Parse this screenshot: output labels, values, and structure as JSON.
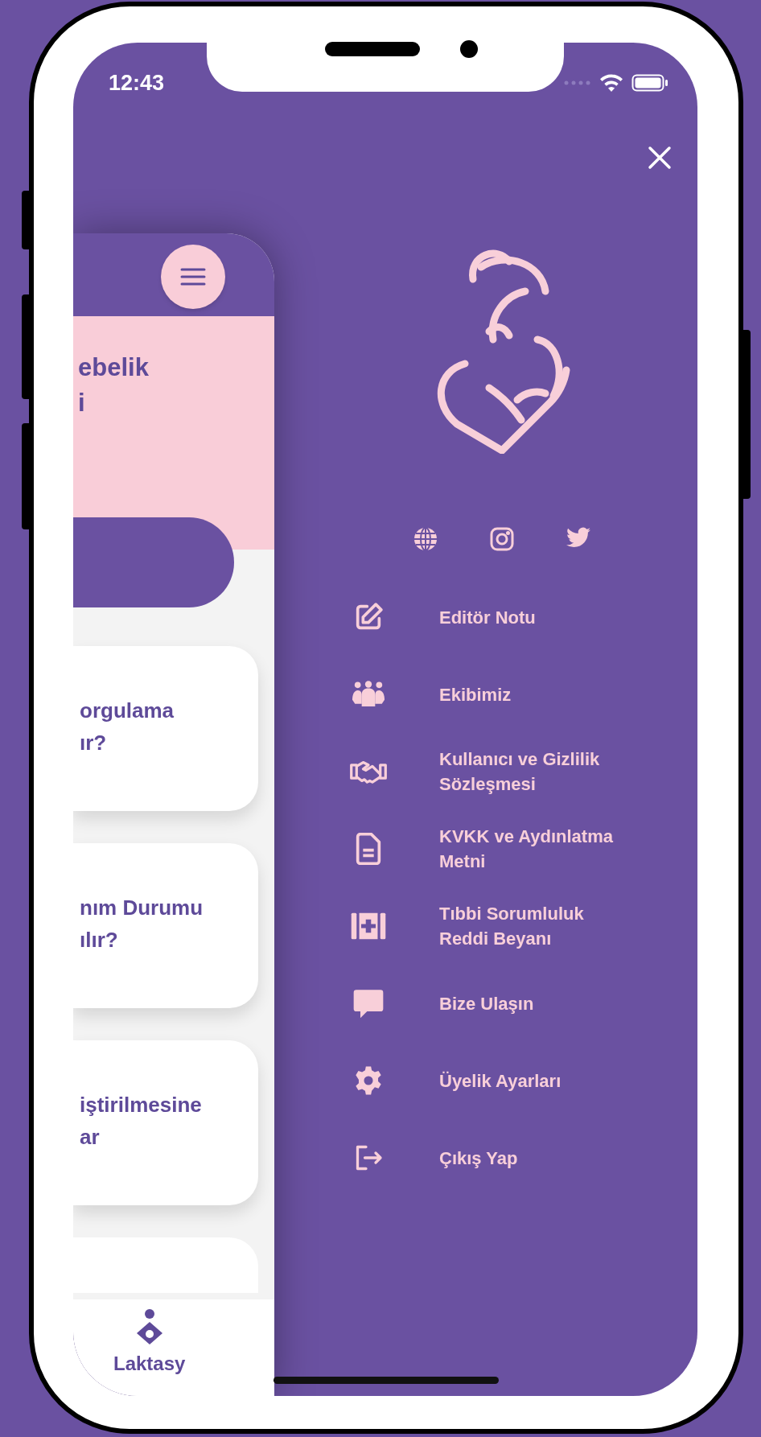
{
  "status_bar": {
    "time": "12:43"
  },
  "app_screen": {
    "hero_text": "ebelik\ni",
    "cards": [
      {
        "text": "orgulama\nır?"
      },
      {
        "text": "nım Durumu\nılır?"
      },
      {
        "text": "iştirilmesine\nar"
      }
    ],
    "bottom_nav": {
      "label": "Laktasy"
    }
  },
  "drawer": {
    "menu": [
      {
        "label": "Editör Notu"
      },
      {
        "label": "Ekibimiz"
      },
      {
        "label": "Kullanıcı ve Gizlilik\nSözleşmesi"
      },
      {
        "label": "KVKK ve Aydınlatma\nMetni"
      },
      {
        "label": "Tıbbi Sorumluluk\nReddi Beyanı"
      },
      {
        "label": "Bize Ulaşın"
      },
      {
        "label": "Üyelik Ayarları"
      },
      {
        "label": "Çıkış Yap"
      }
    ]
  }
}
